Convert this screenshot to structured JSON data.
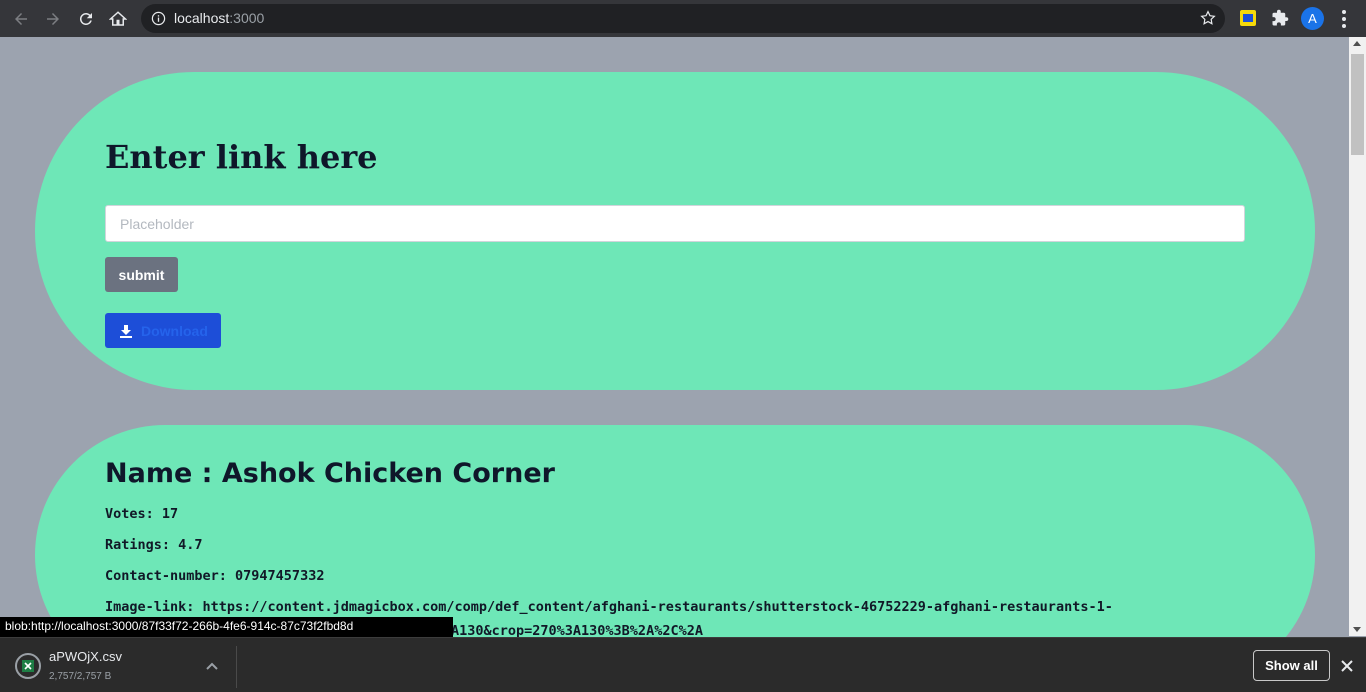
{
  "browser": {
    "url_host": "localhost",
    "url_port": ":3000"
  },
  "form": {
    "title": "Enter link here",
    "input_placeholder": "Placeholder",
    "input_value": "",
    "submit_label": "submit",
    "download_label": "Download"
  },
  "result": {
    "name": "Name : Ashok Chicken Corner",
    "votes": "Votes: 17",
    "ratings": "Ratings: 4.7",
    "contact": "Contact-number: 07947457332",
    "image_link_line1": "Image-link: https://content.jdmagicbox.com/comp/def_content/afghani-restaurants/shutterstock-46752229-afghani-restaurants-1-",
    "image_link_line2_visible": "A130&crop=270%3A130%3B%2A%2C%2A"
  },
  "status_bar": {
    "url": "blob:http://localhost:3000/87f33f72-266b-4fe6-914c-87c73f2fbd8d"
  },
  "download_shelf": {
    "file_name": "aPWOjX.csv",
    "file_size": "2,757/2,757 B",
    "show_all_label": "Show all"
  },
  "colors": {
    "page_bg": "#9ca3af",
    "card_bg": "#6ee7b7",
    "submit_bg": "#6b7280",
    "download_bg": "#1d4ed8"
  }
}
